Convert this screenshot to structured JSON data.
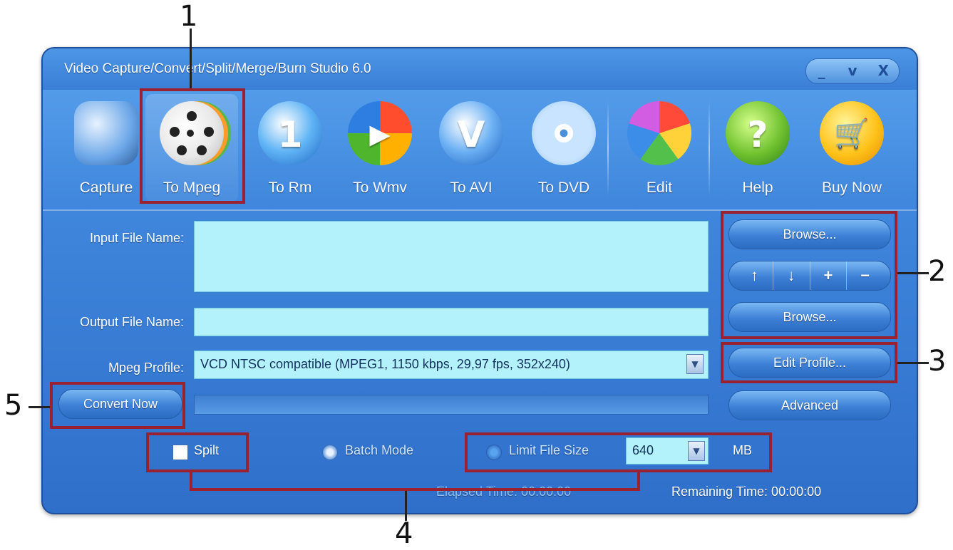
{
  "window": {
    "title": "Video Capture/Convert/Split/Merge/Burn Studio 6.0",
    "controls": [
      "_",
      "v",
      "X"
    ]
  },
  "toolbar": [
    {
      "label": "Capture",
      "icon": "camera-icon"
    },
    {
      "label": "To Mpeg",
      "icon": "film-reel-icon",
      "active": true
    },
    {
      "label": "To Rm",
      "icon": "realmedia-icon"
    },
    {
      "label": "To Wmv",
      "icon": "windows-media-icon"
    },
    {
      "label": "To AVI",
      "icon": "avi-icon"
    },
    {
      "label": "To DVD",
      "icon": "dvd-disc-icon"
    },
    {
      "label": "Edit",
      "icon": "palette-icon"
    },
    {
      "label": "Help",
      "icon": "help-icon"
    },
    {
      "label": "Buy Now",
      "icon": "shopping-cart-icon"
    }
  ],
  "form": {
    "input_label": "Input File Name:",
    "input_value": "",
    "output_label": "Output File Name:",
    "output_value": "",
    "profile_label": "Mpeg Profile:",
    "profile_value": "VCD NTSC compatible (MPEG1, 1150 kbps, 29,97 fps, 352x240)"
  },
  "buttons": {
    "browse_input": "Browse...",
    "browse_output": "Browse...",
    "edit_profile": "Edit Profile...",
    "advanced": "Advanced",
    "convert_now": "Convert Now",
    "list_controls": [
      "↑",
      "↓",
      "+",
      "−"
    ]
  },
  "options": {
    "split_label": "Spilt",
    "split_checked": false,
    "batch_label": "Batch Mode",
    "limit_label": "Limit File Size",
    "limit_value": "640",
    "limit_unit": "MB"
  },
  "status": {
    "elapsed": "Elapsed Time: 00:00:00",
    "remaining": "Remaining Time: 00:00:00"
  },
  "annotations": [
    "1",
    "2",
    "3",
    "4",
    "5"
  ],
  "colors": {
    "window_blue": "#3f86dc",
    "field_cyan": "#b4f2fb",
    "annotation_red": "#9a2230"
  }
}
